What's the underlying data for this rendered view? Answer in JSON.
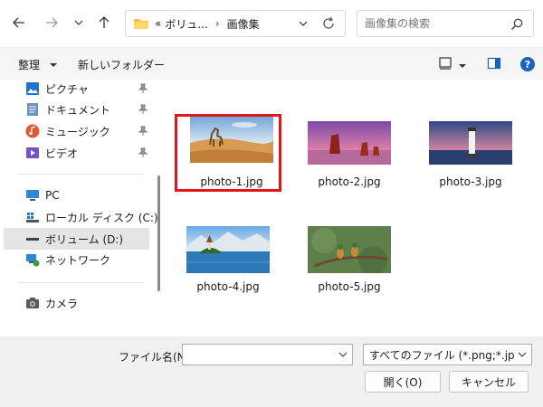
{
  "address": {
    "crumbs": [
      "ボリュ...",
      "画像集"
    ],
    "prefix": "«",
    "separator": "›"
  },
  "search": {
    "placeholder": "画像集の検索"
  },
  "toolbar": {
    "organize_label": "整理",
    "new_folder_label": "新しいフォルダー"
  },
  "sidebar": {
    "quick_access": [
      {
        "label": "ピクチャ",
        "icon": "pictures-icon"
      },
      {
        "label": "ドキュメント",
        "icon": "documents-icon"
      },
      {
        "label": "ミュージック",
        "icon": "music-icon"
      },
      {
        "label": "ビデオ",
        "icon": "videos-icon"
      }
    ],
    "pc_label": "PC",
    "drives": [
      {
        "label": "ローカル ディスク (C:)",
        "icon": "local-disk-icon"
      },
      {
        "label": "ボリューム (D:)",
        "icon": "volume-drive-icon"
      }
    ],
    "network_label": "ネットワーク",
    "camera_label": "カメラ"
  },
  "files": [
    {
      "name": "photo-1.jpg"
    },
    {
      "name": "photo-2.jpg"
    },
    {
      "name": "photo-3.jpg"
    },
    {
      "name": "photo-4.jpg"
    },
    {
      "name": "photo-5.jpg"
    }
  ],
  "footer": {
    "filename_label": "ファイル名(N):",
    "filename_value": "",
    "filter_value": "すべてのファイル (*.png;*.jpg;*.jpe",
    "open_label": "開く(O)",
    "cancel_label": "キャンセル"
  },
  "colors": {
    "highlight": "#e8121a",
    "accent": "#0067c0",
    "selected_row": "#e5e5e5"
  }
}
